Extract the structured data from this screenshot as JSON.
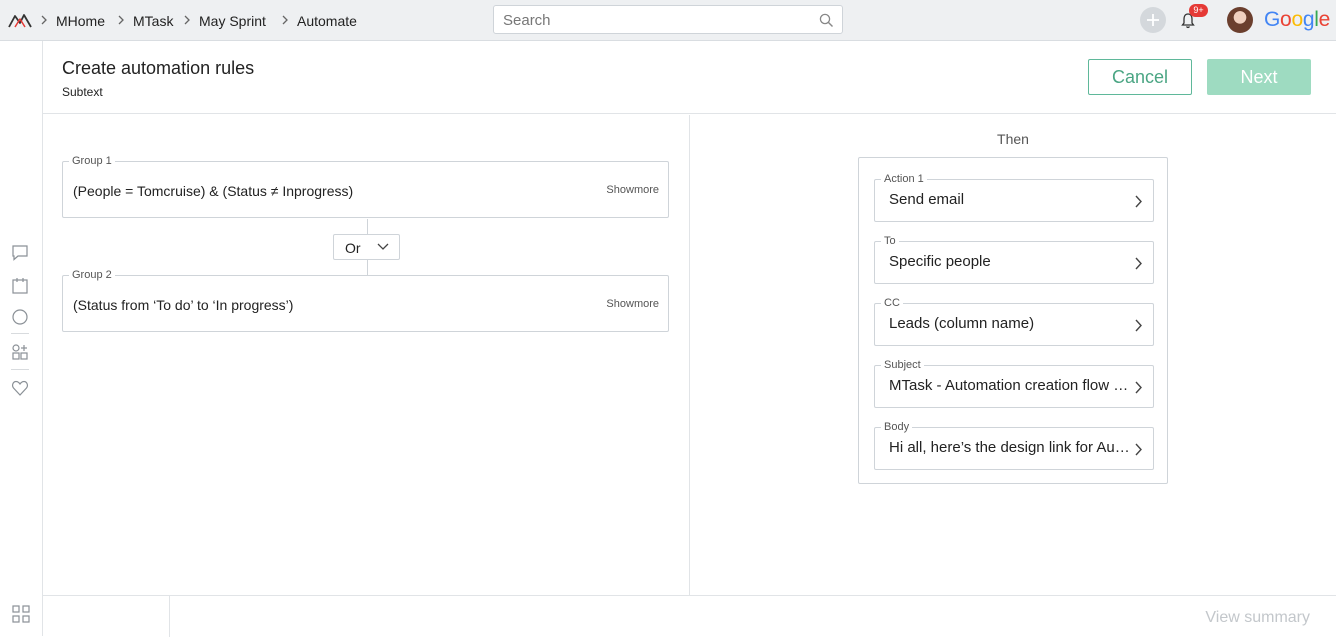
{
  "topbar": {
    "breadcrumbs": [
      "MHome",
      "MTask",
      "May Sprint",
      "Automate"
    ],
    "search_placeholder": "Search",
    "notification_badge": "9+",
    "brand": "Google",
    "brand_colors": [
      "#4285F4",
      "#EA4335",
      "#FBBC05",
      "#4285F4",
      "#34A853",
      "#EA4335"
    ]
  },
  "header": {
    "title": "Create automation rules",
    "subtext": "Subtext",
    "cancel_label": "Cancel",
    "next_label": "Next"
  },
  "conditions": {
    "groups": [
      {
        "legend": "Group 1",
        "text": "(People  =  Tomcruise)  & (Status ≠ Inprogress)",
        "showmore": "Showmore"
      },
      {
        "legend": "Group 2",
        "text": "(Status from ‘To do’ to ‘In progress’)",
        "showmore": "Showmore"
      }
    ],
    "operator": "Or"
  },
  "then": {
    "label": "Then",
    "fields": [
      {
        "legend": "Action 1",
        "value": "Send email"
      },
      {
        "legend": "To",
        "value": "Specific people"
      },
      {
        "legend": "CC",
        "value": "Leads (column name)"
      },
      {
        "legend": "Subject",
        "value": "MTask - Automation  creation flow design"
      },
      {
        "legend": "Body",
        "value": "Hi all, here’s the design link for Automation creation flow"
      }
    ]
  },
  "footer": {
    "view_summary": "View summary"
  },
  "colors": {
    "accent": "#4aa583",
    "next_bg": "#9edbc1",
    "badge": "#e53935"
  }
}
